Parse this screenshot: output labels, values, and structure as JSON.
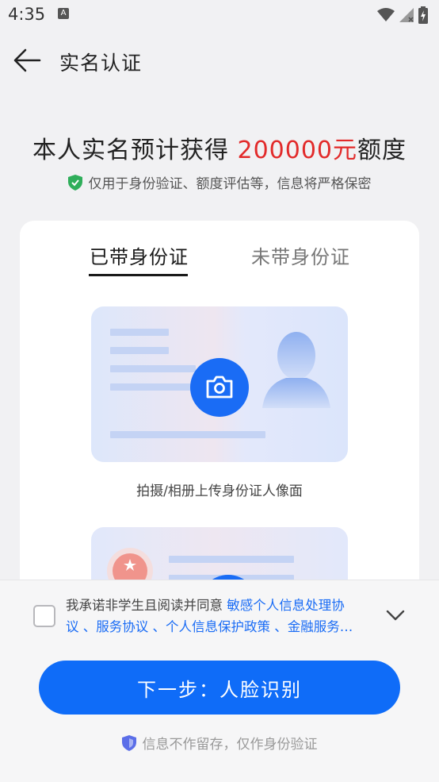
{
  "status": {
    "time": "4:35",
    "notification_glyph": "A"
  },
  "appbar": {
    "title": "实名认证"
  },
  "headline": {
    "prefix": "本人实名预计获得 ",
    "amount": "200000",
    "unit": "元",
    "suffix": "额度"
  },
  "subline": {
    "text": "仅用于身份验证、额度评估等，信息将严格保密"
  },
  "tabs": [
    {
      "label": "已带身份证",
      "active": true
    },
    {
      "label": "未带身份证",
      "active": false
    }
  ],
  "id_front": {
    "caption": "拍摄/相册上传身份证人像面"
  },
  "agreement": {
    "prefix": "我承诺非学生且阅读并同意 ",
    "links_line1": "敏感个人信息处理协",
    "links_line2": "议 、服务协议 、个人信息保护政策 、金融服务…"
  },
  "next_button": {
    "label": "下一步：人脸识别"
  },
  "privacy_note": {
    "text": "信息不作留存，仅作身份验证"
  },
  "colors": {
    "accent": "#0f6cf8",
    "amount_red": "#e22a2a",
    "shield_green": "#2fae5a"
  }
}
